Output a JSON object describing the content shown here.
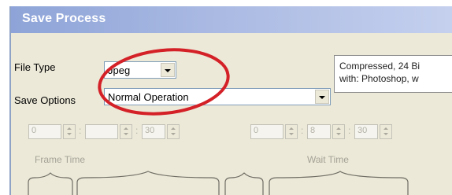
{
  "window": {
    "title": "Save Process"
  },
  "file_type": {
    "label": "File Type",
    "value": "Jpeg"
  },
  "save_options": {
    "label": "Save Options",
    "value": "Normal Operation"
  },
  "info": {
    "line1": "Compressed, 24 Bi",
    "line2": "with: Photoshop, w"
  },
  "frame_time": {
    "label": "Frame Time",
    "fields": [
      "0",
      "",
      "30"
    ]
  },
  "wait_time": {
    "label": "Wait Time",
    "fields": [
      "0",
      "8",
      "30"
    ]
  },
  "annotation_color": "#d42027"
}
